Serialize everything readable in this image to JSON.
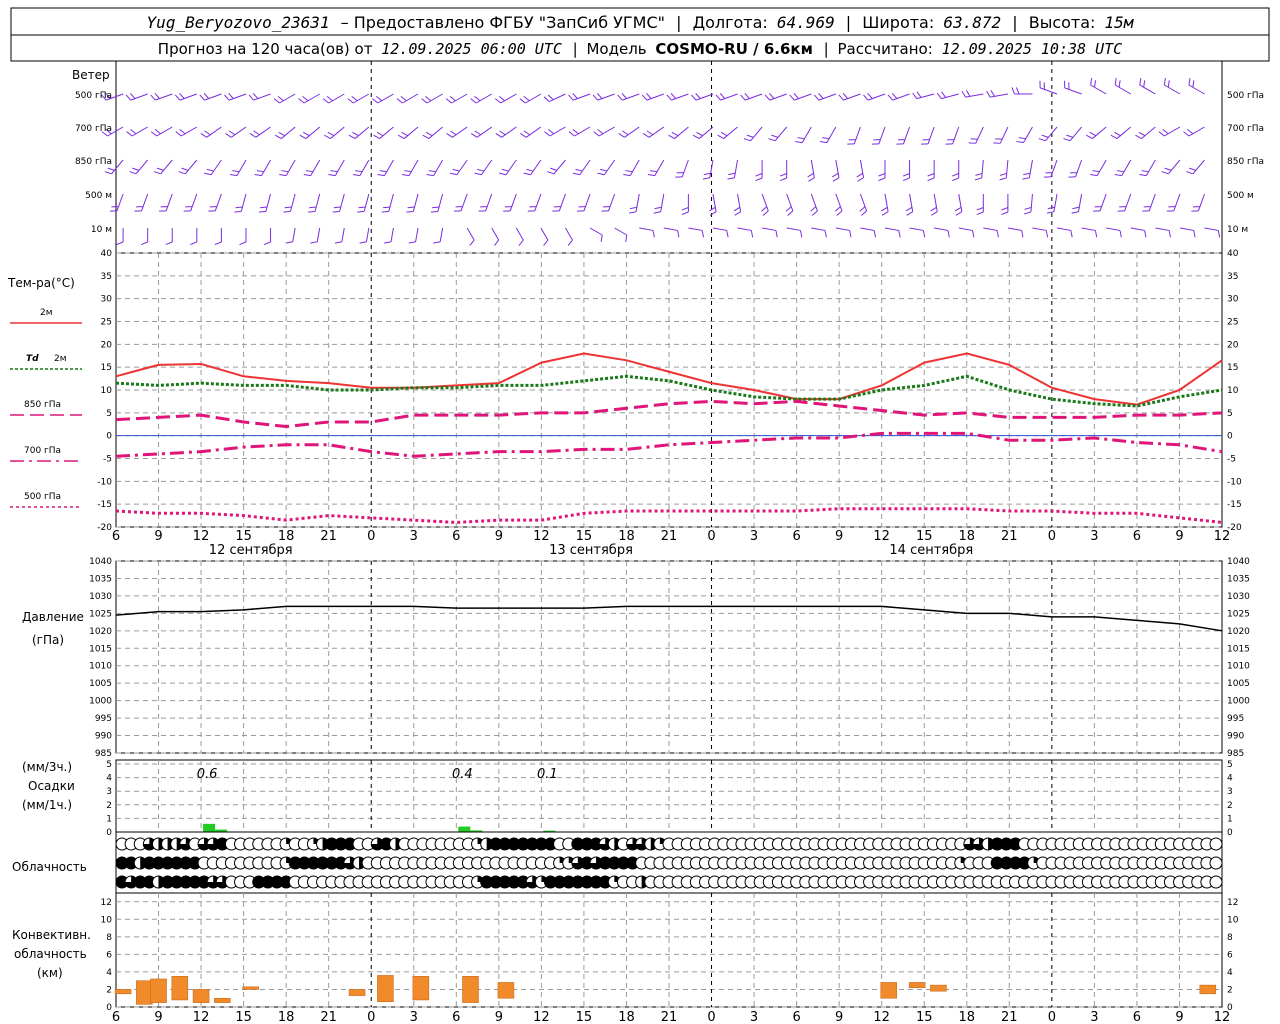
{
  "header": {
    "station": "Yug_Beryozovo_23631",
    "provider": "– Предоставлено ФГБУ \"ЗапСиб УГМС\"",
    "lon_label": "Долгота:",
    "lon": "64.969",
    "lat_label": "Широта:",
    "lat": "63.872",
    "alt_label": "Высота:",
    "alt": "15м",
    "forecast_label": "Прогноз на 120 часа(ов) от",
    "forecast_from": "12.09.2025 06:00 UTC",
    "model_label": "Модель",
    "model": "COSMO-RU / 6.6км",
    "calc_label": "Рассчитано:",
    "calc": "12.09.2025 10:38 UTC"
  },
  "wind_panel": {
    "title": "Ветер",
    "levels": [
      "500 гПа",
      "700 гПа",
      "850 гПа",
      "500 м",
      "10 м"
    ],
    "right_levels": [
      "500 гПа",
      "700 гПа",
      "850 гПа",
      "500 м",
      "10 м"
    ],
    "color": "#7a2be0"
  },
  "temp_panel": {
    "title": "Тем-ра(°C)",
    "legend": [
      {
        "label": "2м",
        "color": "#ee3333",
        "style": "solid"
      },
      {
        "label_a": "Td",
        "label_b": "2м",
        "color": "#1a7a1a",
        "style": "dotted"
      },
      {
        "label": "850 гПа",
        "color": "#e0157a",
        "style": "dash"
      },
      {
        "label": "700 гПа",
        "color": "#e0157a",
        "style": "dashdot"
      },
      {
        "label": "500 гПа",
        "color": "#e0157a",
        "style": "dot"
      }
    ],
    "y_ticks": [
      "40",
      "35",
      "30",
      "25",
      "20",
      "15",
      "10",
      "5",
      "0",
      "-5",
      "-10",
      "-15",
      "-20"
    ]
  },
  "pressure_panel": {
    "title": "Давление",
    "unit": "(гПа)",
    "y_ticks": [
      "1040",
      "1035",
      "1030",
      "1025",
      "1020",
      "1015",
      "1010",
      "1005",
      "1000",
      "995",
      "990",
      "985"
    ]
  },
  "precip_panel": {
    "unit_top": "(мм/3ч.)",
    "title": "Осадки",
    "unit_bottom": "(мм/1ч.)",
    "y_ticks": [
      "5",
      "4",
      "3",
      "2",
      "1",
      "0"
    ],
    "totals": [
      "0.6",
      "0.4",
      "0.1"
    ]
  },
  "cloud_panel": {
    "title": "Облачность"
  },
  "conv_panel": {
    "title_a": "Конвективн.",
    "title_b": "облачность",
    "unit": "(км)",
    "y_ticks": [
      "12",
      "10",
      "8",
      "6",
      "4",
      "2",
      "0"
    ]
  },
  "x_axis": {
    "hour_labels": [
      "6",
      "9",
      "12",
      "15",
      "18",
      "21",
      "0",
      "3",
      "6",
      "9",
      "12",
      "15",
      "18",
      "21",
      "0",
      "3",
      "6",
      "9",
      "12",
      "15",
      "18",
      "21",
      "0",
      "3",
      "6",
      "9",
      "12"
    ],
    "dates": [
      "12 сентября",
      "13 сентября",
      "14 сентября"
    ]
  },
  "chart_data": {
    "type": "line",
    "x_hours": [
      0,
      3,
      6,
      9,
      12,
      15,
      18,
      21,
      24,
      27,
      30,
      33,
      36,
      39,
      42,
      45,
      48,
      51,
      54,
      57,
      60,
      63,
      66,
      69,
      72,
      75,
      78
    ],
    "series": [
      {
        "name": "2м",
        "unit": "°C",
        "values": [
          13,
          15.5,
          15.7,
          13,
          12,
          11.5,
          10.5,
          10.5,
          11,
          11.5,
          16,
          18,
          16.5,
          14,
          11.5,
          10,
          8,
          8,
          11,
          16,
          18,
          15.5,
          10.5,
          8,
          6.8,
          10,
          16.5
        ]
      },
      {
        "name": "Td 2м",
        "unit": "°C",
        "values": [
          11.5,
          11,
          11.5,
          11,
          11,
          10,
          10,
          10.5,
          10.5,
          11,
          11,
          12,
          13,
          12,
          10,
          8.5,
          8,
          8,
          10,
          11,
          13,
          10,
          8,
          7,
          6.5,
          8.5,
          10
        ]
      },
      {
        "name": "850 гПа",
        "unit": "°C",
        "values": [
          3.5,
          4,
          4.5,
          3,
          2,
          3,
          3,
          4.5,
          4.5,
          4.5,
          5,
          5,
          6,
          7,
          7.5,
          7,
          7.5,
          6.5,
          5.5,
          4.5,
          5,
          4,
          4,
          4,
          4.5,
          4.5,
          5
        ]
      },
      {
        "name": "700 гПа",
        "unit": "°C",
        "values": [
          -4.5,
          -4,
          -3.5,
          -2.5,
          -2,
          -2,
          -3.5,
          -4.5,
          -4,
          -3.5,
          -3.5,
          -3,
          -3,
          -2,
          -1.5,
          -1,
          -0.5,
          -0.5,
          0.5,
          0.5,
          0.5,
          -1,
          -1,
          -0.5,
          -1.5,
          -2,
          -3.5
        ]
      },
      {
        "name": "500 гПа",
        "unit": "°C",
        "values": [
          -16.5,
          -17,
          -17,
          -17.5,
          -18.5,
          -17.5,
          -18,
          -18.5,
          -19,
          -18.5,
          -18.5,
          -17,
          -16.5,
          -16.5,
          -16.5,
          -16.5,
          -16.5,
          -16,
          -16,
          -16,
          -16,
          -16.5,
          -16.5,
          -17,
          -17,
          -18,
          -19
        ]
      },
      {
        "name": "Давление",
        "unit": "гПа",
        "values": [
          1024.5,
          1025.5,
          1025.5,
          1026,
          1027,
          1027,
          1027,
          1027,
          1026.5,
          1026.5,
          1026.5,
          1026.5,
          1027,
          1027,
          1027,
          1027,
          1027,
          1027,
          1027,
          1026,
          1025,
          1025,
          1024,
          1024,
          1023,
          1022,
          1020
        ]
      },
      {
        "name": "Осадки",
        "unit": "мм/3ч",
        "values": [
          0,
          0,
          0.6,
          0,
          0,
          0,
          0,
          0,
          0.4,
          0,
          0.1,
          0,
          0,
          0,
          0,
          0,
          0,
          0,
          0,
          0,
          0,
          0,
          0,
          0,
          0,
          0,
          0
        ]
      }
    ],
    "ylim_temp": [
      -20,
      40
    ],
    "ylim_pressure": [
      985,
      1040
    ],
    "ylim_precip": [
      0,
      5
    ],
    "ylim_convective": [
      0,
      13
    ],
    "convective_cloud_km": [
      {
        "h": 0.5,
        "base": 1.5,
        "top": 2
      },
      {
        "h": 2,
        "base": 0.3,
        "top": 3
      },
      {
        "h": 3,
        "base": 0.5,
        "top": 3.2
      },
      {
        "h": 4.5,
        "base": 0.8,
        "top": 3.5
      },
      {
        "h": 6,
        "base": 0.5,
        "top": 2
      },
      {
        "h": 7.5,
        "base": 0.5,
        "top": 1
      },
      {
        "h": 9.5,
        "base": 2,
        "top": 2.3
      },
      {
        "h": 17,
        "base": 1.3,
        "top": 2
      },
      {
        "h": 19,
        "base": 0.6,
        "top": 3.6
      },
      {
        "h": 21.5,
        "base": 0.8,
        "top": 3.5
      },
      {
        "h": 25,
        "base": 0.5,
        "top": 3.5
      },
      {
        "h": 27.5,
        "base": 1,
        "top": 2.8
      },
      {
        "h": 54.5,
        "base": 1,
        "top": 2.8
      },
      {
        "h": 56.5,
        "base": 2.2,
        "top": 2.8
      },
      {
        "h": 58,
        "base": 1.8,
        "top": 2.5
      },
      {
        "h": 77,
        "base": 1.5,
        "top": 2.5
      }
    ],
    "cloud_cover_rows": [
      "0003222303340000001001244400342000000001244444440044432033210000000000000000000000000000000003324440000000000000000000000",
      "4424444440000000001444444320000000000000000000001134344440000000000000000000000000000000000010004444100000000000000000000",
      "4344244444330004444000000000000000000001444443144444441002000000000000000000000000000000000000000000000000000000000000000"
    ]
  }
}
